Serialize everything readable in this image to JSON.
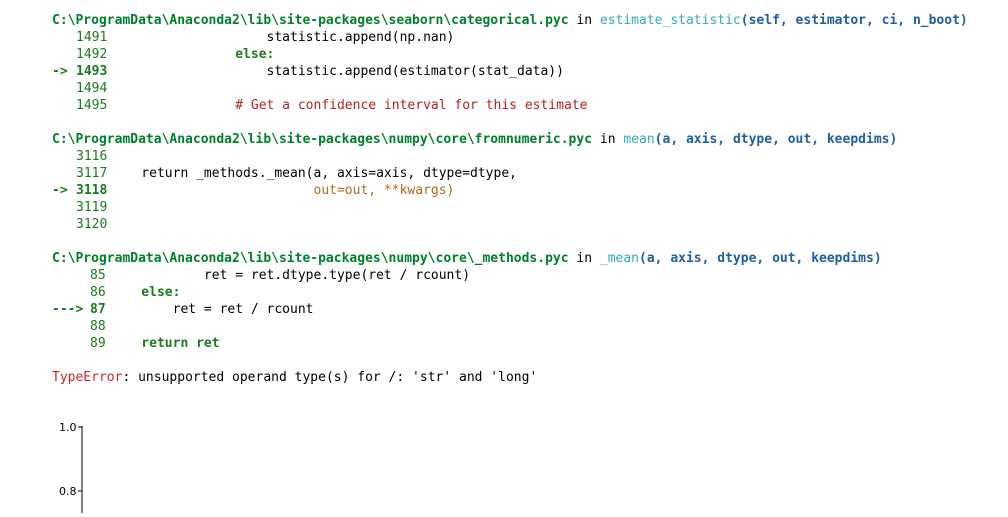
{
  "traceback": {
    "frames": [
      {
        "file": "C:\\ProgramData\\Anaconda2\\lib\\site-packages\\seaborn\\categorical.pyc",
        "in_word": "in",
        "func": "estimate_statistic",
        "args": "(self, estimator, ci, n_boot)",
        "lines": [
          {
            "no": "1491",
            "code": "                    statistic.append(np.nan)"
          },
          {
            "no": "1492",
            "code": "                else:"
          },
          {
            "no": "1493",
            "code": "                    statistic.append(estimator(stat_data))",
            "arrow": "->"
          },
          {
            "no": "1494",
            "code": ""
          },
          {
            "no": "1495",
            "code": "                # Get a confidence interval for this estimate"
          }
        ]
      },
      {
        "file": "C:\\ProgramData\\Anaconda2\\lib\\site-packages\\numpy\\core\\fromnumeric.pyc",
        "in_word": "in",
        "func": "mean",
        "args": "(a, axis, dtype, out, keepdims)",
        "lines": [
          {
            "no": "3116",
            "code": ""
          },
          {
            "no": "3117",
            "code": "    return _methods._mean(a, axis=axis, dtype=dtype,"
          },
          {
            "no": "3118",
            "code": "                          out=out, **kwargs)",
            "arrow": "->"
          },
          {
            "no": "3119",
            "code": ""
          },
          {
            "no": "3120",
            "code": ""
          }
        ]
      },
      {
        "file": "C:\\ProgramData\\Anaconda2\\lib\\site-packages\\numpy\\core\\_methods.pyc",
        "in_word": "in",
        "func": "_mean",
        "args": "(a, axis, dtype, out, keepdims)",
        "lines": [
          {
            "no": "85",
            "code": "            ret = ret.dtype.type(ret / rcount)"
          },
          {
            "no": "86",
            "code": "    else:"
          },
          {
            "no": "87",
            "code": "        ret = ret / rcount",
            "arrow": "--->"
          },
          {
            "no": "88",
            "code": ""
          },
          {
            "no": "89",
            "code": "    return ret"
          }
        ]
      }
    ],
    "error_type": "TypeError",
    "error_message": ": unsupported operand type(s) for /: 'str' and 'long'"
  },
  "plot_stub": {
    "tick_labels": [
      "1.0",
      "0.8"
    ]
  }
}
